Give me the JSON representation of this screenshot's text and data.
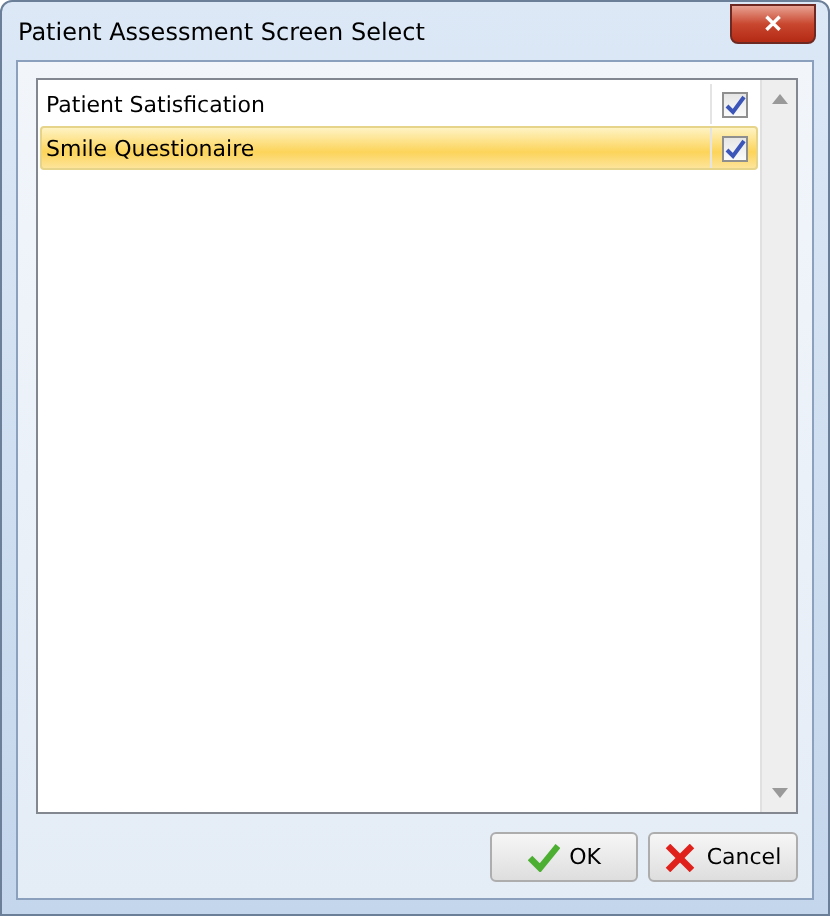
{
  "window": {
    "title": "Patient Assessment Screen Select",
    "close": "✕"
  },
  "items": [
    {
      "label": "Patient Satisfication",
      "checked": true,
      "selected": false
    },
    {
      "label": "Smile Questionaire",
      "checked": true,
      "selected": true
    }
  ],
  "buttons": [
    {
      "kind": "ok",
      "label": "OK"
    },
    {
      "kind": "cancel",
      "label": "Cancel"
    }
  ]
}
